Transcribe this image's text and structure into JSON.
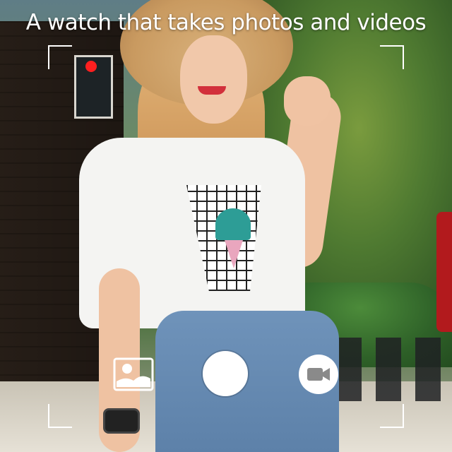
{
  "headline": "A watch that takes photos and videos",
  "colors": {
    "recording_indicator": "#ff1f1f",
    "overlay_text": "#ffffff",
    "shutter": "#ffffff"
  },
  "controls": {
    "gallery_icon": "image-gallery-icon",
    "shutter_icon": "shutter-circle",
    "video_icon": "video-camera-icon",
    "recording_icon": "recording-dot-icon"
  }
}
